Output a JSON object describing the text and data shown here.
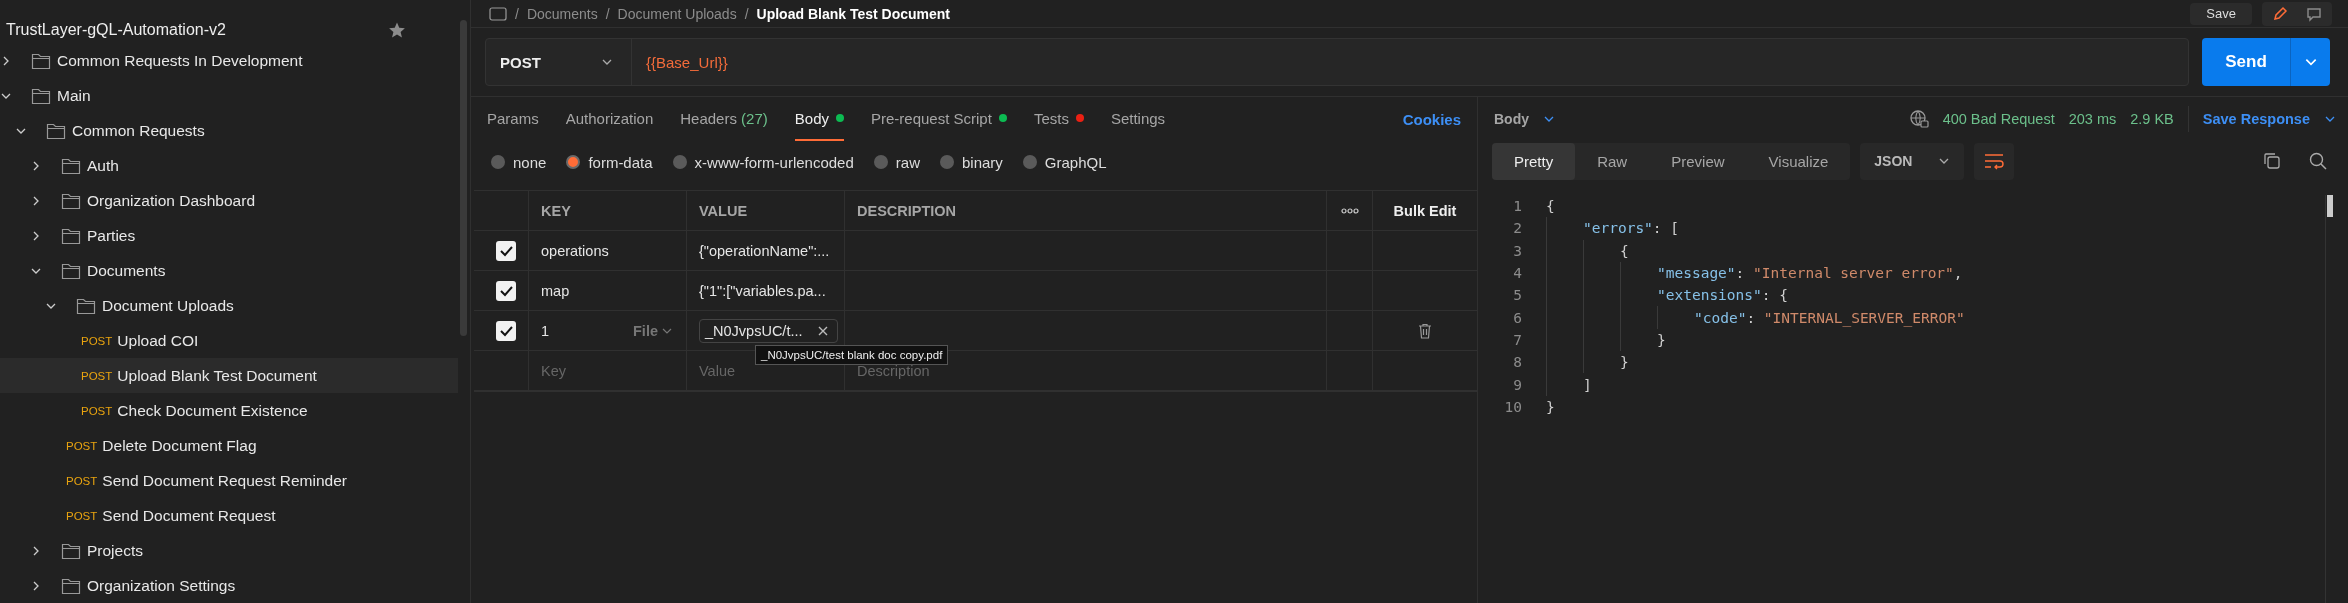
{
  "sidebar": {
    "collection": "TrustLayer-gQL-Automation-v2",
    "items": [
      {
        "kind": "folder",
        "label": "Common Requests In Development",
        "expanded": false
      },
      {
        "kind": "folder",
        "label": "Main",
        "expanded": true,
        "children": [
          {
            "kind": "folder",
            "label": "Common Requests",
            "expanded": true,
            "children": [
              {
                "kind": "folder",
                "label": "Auth",
                "expanded": false
              },
              {
                "kind": "folder",
                "label": "Organization Dashboard",
                "expanded": false
              },
              {
                "kind": "folder",
                "label": "Parties",
                "expanded": false
              },
              {
                "kind": "folder",
                "label": "Documents",
                "expanded": true,
                "children": [
                  {
                    "kind": "folder",
                    "label": "Document Uploads",
                    "expanded": true,
                    "children": [
                      {
                        "kind": "request",
                        "method": "POST",
                        "label": "Upload COI",
                        "selected": false
                      },
                      {
                        "kind": "request",
                        "method": "POST",
                        "label": "Upload Blank Test Document",
                        "selected": true
                      },
                      {
                        "kind": "request",
                        "method": "POST",
                        "label": "Check Document Existence",
                        "selected": false
                      }
                    ]
                  },
                  {
                    "kind": "request",
                    "method": "POST",
                    "label": "Delete Document Flag",
                    "selected": false
                  },
                  {
                    "kind": "request",
                    "method": "POST",
                    "label": "Send Document Request Reminder",
                    "selected": false
                  },
                  {
                    "kind": "request",
                    "method": "POST",
                    "label": "Send Document Request",
                    "selected": false
                  }
                ]
              },
              {
                "kind": "folder",
                "label": "Projects",
                "expanded": false
              },
              {
                "kind": "folder",
                "label": "Organization Settings",
                "expanded": false
              }
            ]
          }
        ]
      }
    ]
  },
  "breadcrumb": [
    {
      "separator": "/",
      "label": "Documents"
    },
    {
      "separator": "/",
      "label": "Document Uploads"
    },
    {
      "separator": "/",
      "label": "Upload Blank Test Document"
    }
  ],
  "save_button": "Save",
  "request": {
    "method": "POST",
    "url": "{{Base_Url}}",
    "send": "Send"
  },
  "tabs": [
    {
      "label": "Params",
      "selected": false
    },
    {
      "label": "Authorization",
      "selected": false
    },
    {
      "label": "Headers",
      "count": "(27)",
      "selected": false
    },
    {
      "label": "Body",
      "color": "#0cbb52",
      "selected": true
    },
    {
      "label": "Pre-request Script",
      "color": "#0cbb52",
      "selected": false
    },
    {
      "label": "Tests",
      "color": "#eb2013",
      "selected": false
    },
    {
      "label": "Settings",
      "selected": false
    }
  ],
  "cookies": "Cookies",
  "body_types": [
    {
      "label": "none",
      "selected": false
    },
    {
      "label": "form-data",
      "selected": true
    },
    {
      "label": "x-www-form-urlencoded",
      "selected": false
    },
    {
      "label": "raw",
      "selected": false
    },
    {
      "label": "binary",
      "selected": false
    },
    {
      "label": "GraphQL",
      "selected": false
    }
  ],
  "params_table": {
    "columns": [
      "KEY",
      "VALUE",
      "DESCRIPTION"
    ],
    "bulk_edit": "Bulk Edit",
    "rows": [
      {
        "kind": "text",
        "checked": true,
        "key": "operations",
        "value": "{\"operationName\":..."
      },
      {
        "kind": "text",
        "checked": true,
        "key": "map",
        "value": "{\"1\":[\"variables.pa..."
      },
      {
        "kind": "file",
        "checked": true,
        "key": "1",
        "type": "File",
        "value": "_N0JvpsUC/t...",
        "tooltip": "_N0JvpsUC/test blank doc copy.pdf"
      }
    ],
    "new_row": {
      "key": {
        "placeholder": "Key"
      },
      "value": {
        "placeholder": "Value"
      },
      "description": {
        "placeholder": "Description"
      }
    }
  },
  "response": {
    "section": "Body",
    "status": "400 Bad Request",
    "time": "203 ms",
    "size": "2.9 KB",
    "save": "Save Response",
    "views": [
      {
        "label": "Pretty",
        "selected": true
      },
      {
        "label": "Raw",
        "selected": false
      },
      {
        "label": "Preview",
        "selected": false
      },
      {
        "label": "Visualize",
        "selected": false
      }
    ],
    "format": "JSON",
    "lines": [
      {
        "number": "1",
        "tokens": [
          {
            "kind": "punct",
            "text": "{"
          }
        ]
      },
      {
        "number": "2",
        "tokens": [
          {
            "kind": "key",
            "text": "\"errors\""
          },
          {
            "kind": "punct",
            "text": ": ["
          }
        ]
      },
      {
        "number": "3",
        "tokens": [
          {
            "kind": "punct",
            "text": "{"
          }
        ]
      },
      {
        "number": "4",
        "tokens": [
          {
            "kind": "key",
            "text": "\"message\""
          },
          {
            "kind": "punct",
            "text": ": "
          },
          {
            "kind": "string",
            "text": "\"Internal server error\""
          },
          {
            "kind": "punct",
            "text": ","
          }
        ]
      },
      {
        "number": "5",
        "tokens": [
          {
            "kind": "key",
            "text": "\"extensions\""
          },
          {
            "kind": "punct",
            "text": ": {"
          }
        ]
      },
      {
        "number": "6",
        "tokens": [
          {
            "kind": "key",
            "text": "\"code\""
          },
          {
            "kind": "punct",
            "text": ": "
          },
          {
            "kind": "string",
            "text": "\"INTERNAL_SERVER_ERROR\""
          }
        ]
      },
      {
        "number": "7",
        "tokens": [
          {
            "kind": "punct",
            "text": "}"
          }
        ]
      },
      {
        "number": "8",
        "tokens": [
          {
            "kind": "punct",
            "text": "}"
          }
        ]
      },
      {
        "number": "9",
        "tokens": [
          {
            "kind": "punct",
            "text": "]"
          }
        ]
      },
      {
        "number": "10",
        "tokens": [
          {
            "kind": "punct",
            "text": "}"
          }
        ]
      }
    ]
  }
}
